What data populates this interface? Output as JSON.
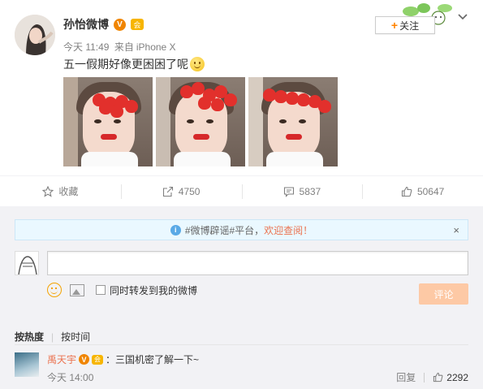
{
  "post": {
    "author": "孙怡微博",
    "verified_badge": "V",
    "vip_badge": "会",
    "time": "今天 11:49",
    "source_prefix": "来自",
    "source": "iPhone X",
    "text": "五一假期好像更困困了呢",
    "emoji_icon": "smile-emoji-icon",
    "follow_label": "关注",
    "images": [
      {
        "name": "photo-1"
      },
      {
        "name": "photo-2"
      },
      {
        "name": "photo-3"
      }
    ]
  },
  "actions": {
    "favorite_label": "收藏",
    "repost_count": "4750",
    "comment_count": "5837",
    "like_count": "50647"
  },
  "comments": {
    "notice_prefix": "#微博辟谣#平台，",
    "notice_link": "欢迎查阅！",
    "notice_close": "×",
    "input_placeholder": "",
    "repost_check_label": "同时转发到我的微博",
    "submit_label": "评论",
    "sort_hot": "按热度",
    "sort_time": "按时间",
    "items": [
      {
        "user": "禹天宇",
        "verified_badge": "V",
        "vip_badge": "会",
        "text": "：三国机密了解一下~",
        "time": "今天 14:00",
        "reply_label": "回复",
        "likes": "2292"
      }
    ]
  },
  "colors": {
    "accent": "#eb7350",
    "verified": "#f08500",
    "submit_disabled": "#fdc9a5",
    "notice_bg": "#eaf8ff"
  }
}
